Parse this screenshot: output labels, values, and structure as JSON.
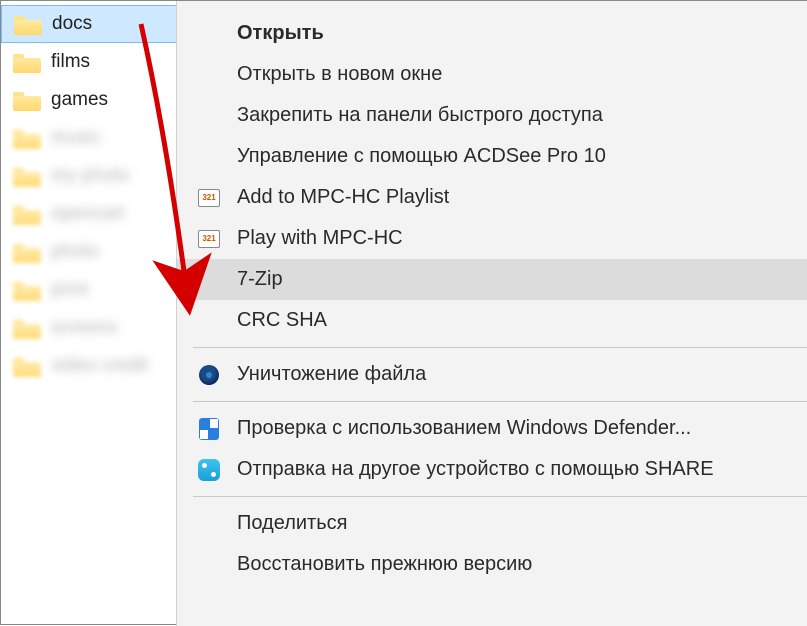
{
  "explorer": {
    "folders": [
      {
        "label": "docs",
        "selected": true,
        "blurred": false
      },
      {
        "label": "films",
        "selected": false,
        "blurred": false
      },
      {
        "label": "games",
        "selected": false,
        "blurred": false
      },
      {
        "label": "music",
        "selected": false,
        "blurred": true
      },
      {
        "label": "my photo",
        "selected": false,
        "blurred": true
      },
      {
        "label": "opencart",
        "selected": false,
        "blurred": true
      },
      {
        "label": "photo",
        "selected": false,
        "blurred": true
      },
      {
        "label": "print",
        "selected": false,
        "blurred": true
      },
      {
        "label": "screens",
        "selected": false,
        "blurred": true
      },
      {
        "label": "video credit",
        "selected": false,
        "blurred": true
      }
    ]
  },
  "context_menu": {
    "items": [
      {
        "type": "item",
        "label": "Открыть",
        "bold": true,
        "icon": null
      },
      {
        "type": "item",
        "label": "Открыть в новом окне",
        "icon": null
      },
      {
        "type": "item",
        "label": "Закрепить на панели быстрого доступа",
        "icon": null
      },
      {
        "type": "item",
        "label": "Управление с помощью ACDSee Pro 10",
        "icon": null
      },
      {
        "type": "item",
        "label": "Add to MPC-HC Playlist",
        "icon": "mpc"
      },
      {
        "type": "item",
        "label": "Play with MPC-HC",
        "icon": "mpc"
      },
      {
        "type": "item",
        "label": "7-Zip",
        "icon": null,
        "hover": true
      },
      {
        "type": "item",
        "label": "CRC SHA",
        "icon": null
      },
      {
        "type": "sep"
      },
      {
        "type": "item",
        "label": "Уничтожение файла",
        "icon": "shred"
      },
      {
        "type": "sep"
      },
      {
        "type": "item",
        "label": "Проверка с использованием Windows Defender...",
        "icon": "shield"
      },
      {
        "type": "item",
        "label": "Отправка на другое устройство с помощью SHARE",
        "icon": "share"
      },
      {
        "type": "sep"
      },
      {
        "type": "item",
        "label": "Поделиться",
        "icon": null
      },
      {
        "type": "item",
        "label": "Восстановить прежнюю версию",
        "icon": null
      }
    ]
  },
  "annotation": {
    "arrow_color": "#d40000"
  }
}
